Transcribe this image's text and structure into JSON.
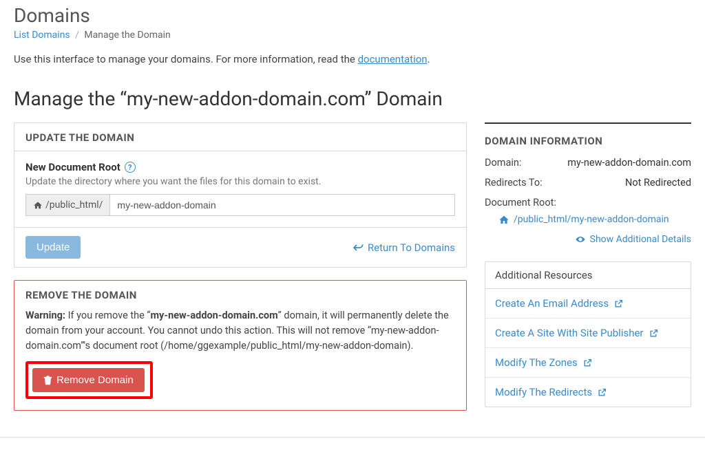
{
  "page": {
    "title": "Domains",
    "breadcrumb": {
      "list_label": "List Domains",
      "current": "Manage the Domain"
    },
    "intro_prefix": "Use this interface to manage your domains. For more information, read the ",
    "intro_link": "documentation",
    "intro_suffix": ".",
    "manage_heading": "Manage the “my-new-addon-domain.com” Domain"
  },
  "update_panel": {
    "header": "UPDATE THE DOMAIN",
    "field_label": "New Document Root",
    "field_desc": "Update the directory where you want the files for this domain to exist.",
    "addon_prefix": "/public_html/",
    "field_value": "my-new-addon-domain",
    "update_button": "Update",
    "return_link": "Return To Domains"
  },
  "remove_panel": {
    "header": "REMOVE THE DOMAIN",
    "warning_label": "Warning:",
    "warning_pre": " If you remove the “",
    "warning_domain": "my-new-addon-domain.com",
    "warning_post": "” domain, it will permanently delete the domain from your account. You cannot undo this action. This will not remove “my-new-addon-domain.com”'s document root (/home/ggexample/public_html/my-new-addon-domain).",
    "remove_button": "Remove Domain"
  },
  "domain_info": {
    "header": "DOMAIN INFORMATION",
    "rows": {
      "domain_label": "Domain:",
      "domain_value": "my-new-addon-domain.com",
      "redirects_label": "Redirects To:",
      "redirects_value": "Not Redirected",
      "docroot_label": "Document Root:",
      "docroot_value": "/public_html/my-new-addon-domain"
    },
    "show_more": "Show Additional Details"
  },
  "resources": {
    "header": "Additional Resources",
    "items": [
      "Create An Email Address",
      "Create A Site With Site Publisher",
      "Modify The Zones",
      "Modify The Redirects"
    ]
  }
}
